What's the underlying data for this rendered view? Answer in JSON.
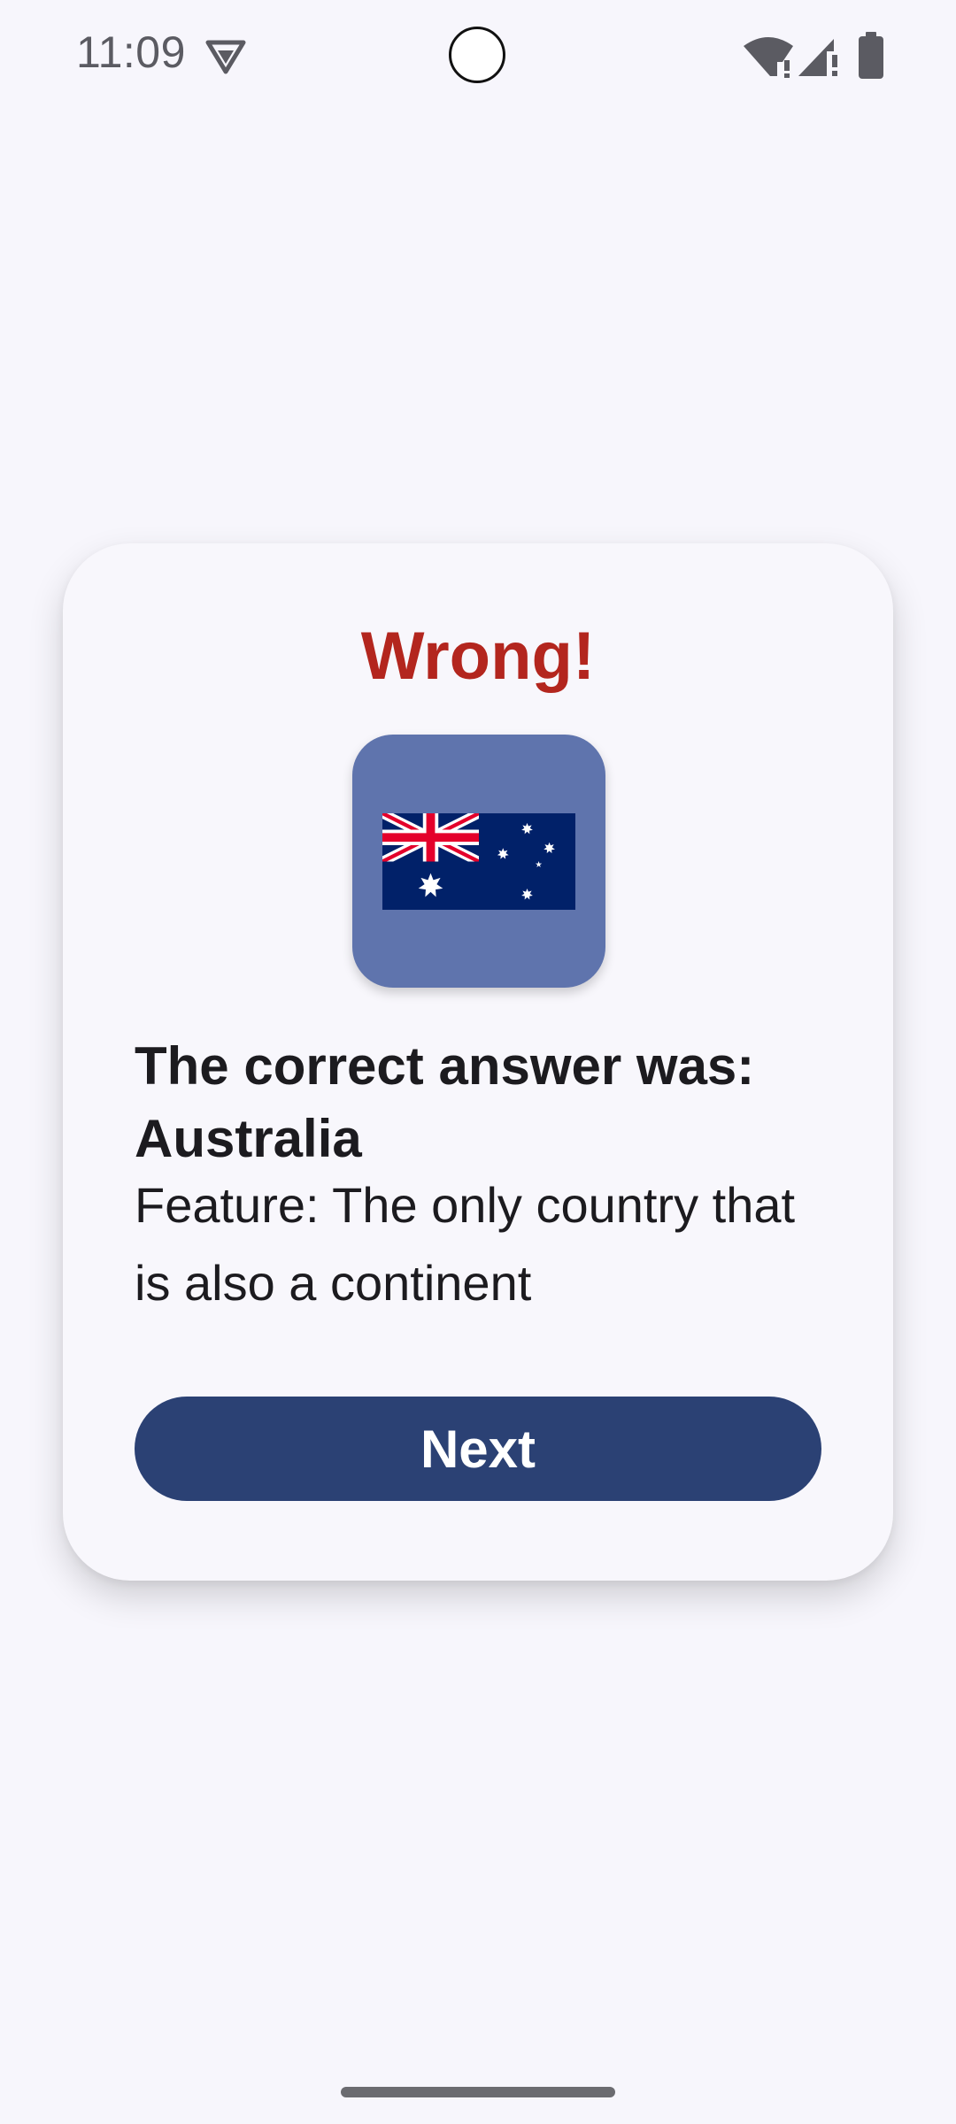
{
  "status_bar": {
    "time": "11:09",
    "icons": [
      "vpn-icon",
      "wifi-icon",
      "signal-icon",
      "battery-icon"
    ]
  },
  "dialog": {
    "title": "Wrong!",
    "flag_icon": "australia-flag-icon",
    "answer_heading": "The correct answer was: Australia",
    "feature": "Feature: The only country that is also a continent",
    "next_label": "Next"
  },
  "colors": {
    "background": "#f7f6fc",
    "card": "#f8f7fc",
    "title_error": "#b3261e",
    "flag_tile": "#5f74ad",
    "button": "#2b4174",
    "button_text": "#ffffff",
    "text": "#1c1b1f"
  }
}
